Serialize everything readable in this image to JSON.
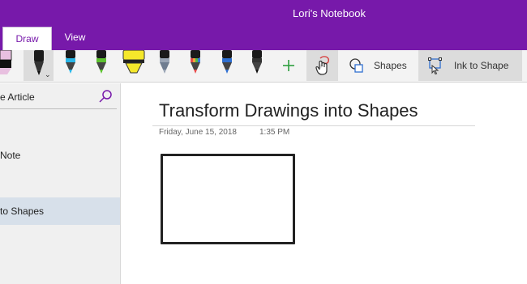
{
  "window": {
    "title": "Lori's Notebook"
  },
  "tabs": [
    {
      "label": "Draw",
      "selected": true
    },
    {
      "label": "View",
      "selected": false
    }
  ],
  "ribbon": {
    "pens": [
      {
        "name": "pen-partial",
        "color": "#e8c0e0"
      },
      {
        "name": "pen-black-selected",
        "color": "#111111"
      },
      {
        "name": "pen-cyan",
        "color": "#29b6e8"
      },
      {
        "name": "pen-green",
        "color": "#5cc12f"
      },
      {
        "name": "highlighter-yellow",
        "color": "#f5e82b"
      },
      {
        "name": "pen-galaxy",
        "color": "#9aa5b5"
      },
      {
        "name": "pen-rainbow",
        "color": "#e54b4b"
      },
      {
        "name": "pen-blue",
        "color": "#2f6fd0"
      },
      {
        "name": "pen-black",
        "color": "#111111"
      }
    ],
    "add_pen_icon": "plus-icon",
    "lasso_icon": "lasso-select-icon",
    "shapes_label": "Shapes",
    "ink_to_shape_label": "Ink to Shape"
  },
  "sidebar": {
    "search_text": "e Article",
    "pages": [
      {
        "label": "Note",
        "selected": false
      },
      {
        "label": "to Shapes",
        "selected": true
      }
    ]
  },
  "page": {
    "title": "Transform Drawings into Shapes",
    "date": "Friday, June 15, 2018",
    "time": "1:35 PM"
  },
  "colors": {
    "accent": "#7719aa",
    "selected_page": "#d7e0ea"
  }
}
